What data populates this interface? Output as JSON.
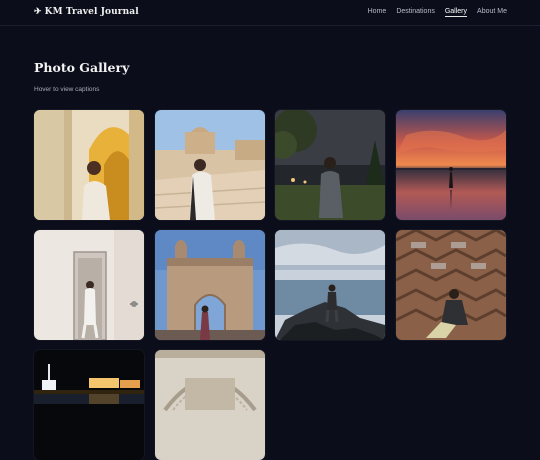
{
  "nav": {
    "brand_icon": "airplane-icon",
    "brand": "KM Travel Journal",
    "links": [
      {
        "label": "Home",
        "active": false
      },
      {
        "label": "Destinations",
        "active": false
      },
      {
        "label": "Gallery",
        "active": true
      },
      {
        "label": "About Me",
        "active": false
      }
    ]
  },
  "gallery": {
    "title": "Photo Gallery",
    "subtitle": "Hover to view captions",
    "photos": [
      {
        "caption": ""
      },
      {
        "caption": ""
      },
      {
        "caption": ""
      },
      {
        "caption": ""
      },
      {
        "caption": ""
      },
      {
        "caption": ""
      },
      {
        "caption": ""
      },
      {
        "caption": ""
      },
      {
        "caption": ""
      },
      {
        "caption": ""
      }
    ]
  },
  "colors": {
    "background": "#0b0e1a",
    "text": "#f3f3f3",
    "muted": "#a7abb8"
  }
}
